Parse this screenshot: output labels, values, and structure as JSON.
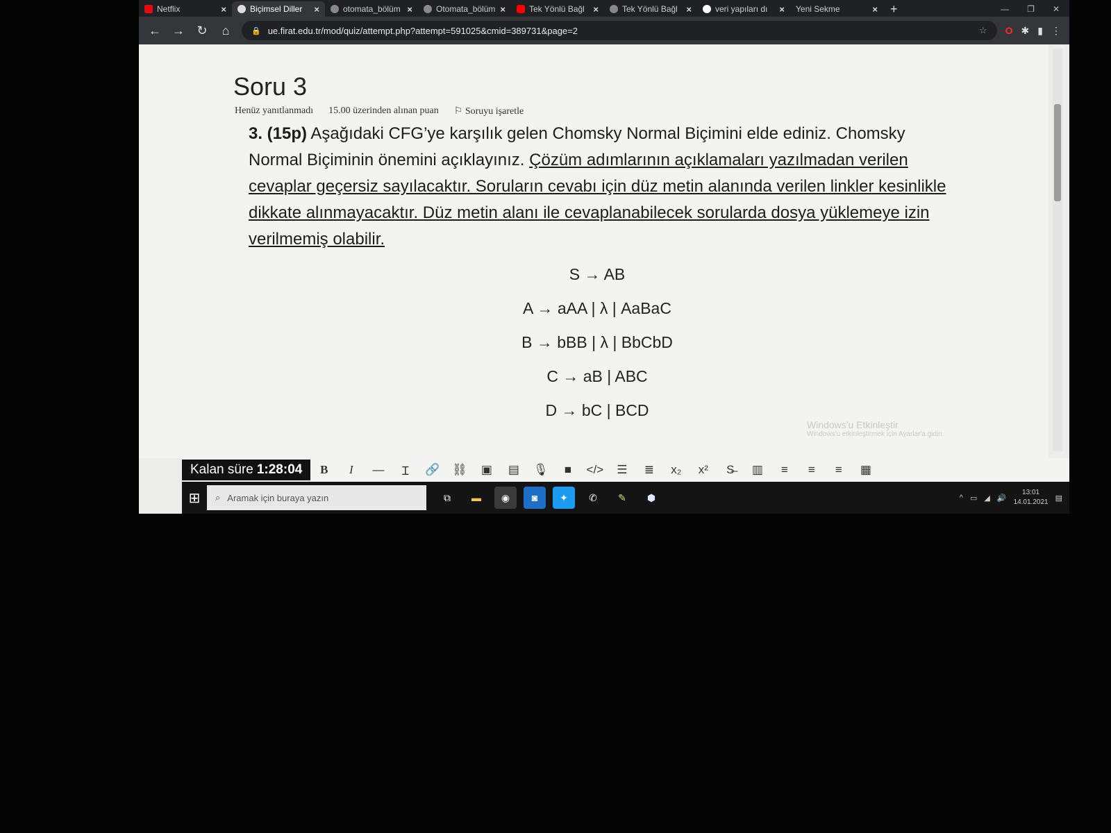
{
  "browser": {
    "tabs": [
      {
        "title": "Netflix",
        "icon": "netflix-icon",
        "active": false
      },
      {
        "title": "Biçimsel Diller",
        "icon": "moodle-icon",
        "active": true
      },
      {
        "title": "otomata_bölüm",
        "icon": "web-icon",
        "active": false
      },
      {
        "title": "Otomata_bölüm",
        "icon": "web-icon",
        "active": false
      },
      {
        "title": "Tek Yönlü Bağl",
        "icon": "youtube-icon",
        "active": false
      },
      {
        "title": "Tek Yönlü Bağl",
        "icon": "web-icon",
        "active": false
      },
      {
        "title": "veri yapıları dı",
        "icon": "google-icon",
        "active": false
      },
      {
        "title": "Yeni Sekme",
        "icon": "",
        "active": false
      }
    ],
    "url": "ue.firat.edu.tr/mod/quiz/attempt.php?attempt=591025&cmid=389731&page=2"
  },
  "question": {
    "title": "Soru 3",
    "status": "Henüz yanıtlanmadı",
    "points": "15.00 üzerinden alınan puan",
    "flag_label": "Soruyu işaretle",
    "number": "3. (15p)",
    "text_plain": "Aşağıdaki CFG’ye karşılık gelen Chomsky Normal Biçimini elde ediniz. Chomsky Normal Biçiminin önemini açıklayınız.",
    "text_underlined": "Çözüm adımlarının açıklamaları yazılmadan verilen cevaplar geçersiz sayılacaktır. Soruların cevabı için düz metin alanında verilen linkler kesinlikle dikkate alınmayacaktır. Düz metin alanı ile cevaplanabilecek sorularda dosya yüklemeye izin verilmemiş olabilir.",
    "grammar": [
      "S → AB",
      "A → aAA | λ | AaBaC",
      "B → bBB | λ | BbCbD",
      "C → aB | ABC",
      "D → bC | BCD"
    ]
  },
  "timer": {
    "label": "Kalan süre",
    "value": "1:28:04"
  },
  "watermark": {
    "line1": "Windows'u Etkinleştir",
    "line2": "Windows'u etkinleştirmek için Ayarlar'a gidin."
  },
  "taskbar": {
    "search_placeholder": "Aramak için buraya yazın",
    "time": "13:01",
    "date": "14.01.2021"
  }
}
